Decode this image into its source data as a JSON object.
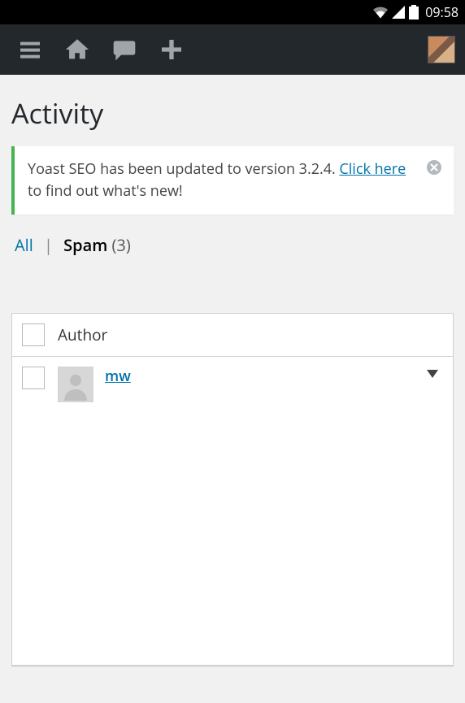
{
  "status_bar": {
    "time": "09:58"
  },
  "admin_bar": {
    "menu_icon": "menu",
    "home_icon": "home",
    "comments_icon": "comments",
    "add_icon": "add"
  },
  "page_title": "Activity",
  "notice": {
    "text_before": "Yoast SEO has been updated to version 3.2.4. ",
    "link_text": "Click here",
    "text_after": " to find out what's new!"
  },
  "filters": {
    "all_label": "All",
    "separator": "|",
    "spam_label": "Spam",
    "spam_count": "(3)"
  },
  "table": {
    "header_author": "Author",
    "rows": [
      {
        "author": "mw"
      }
    ]
  }
}
